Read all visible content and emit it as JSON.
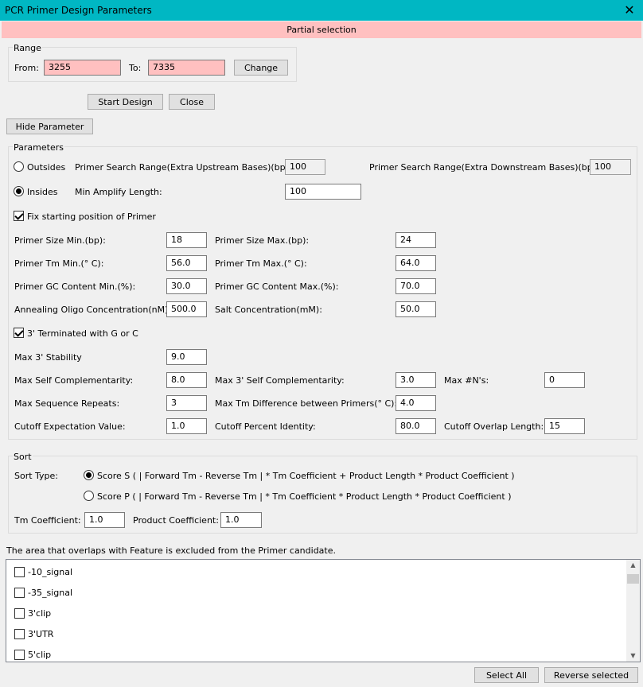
{
  "window": {
    "title": "PCR Primer Design Parameters",
    "close_glyph": "✕"
  },
  "banner": "Partial selection",
  "range": {
    "group_label": "Range",
    "from_label": "From:",
    "from_value": "3255",
    "to_label": "To:",
    "to_value": "7335",
    "change_label": "Change"
  },
  "actions": {
    "start_label": "Start Design",
    "close_label": "Close",
    "hide_label": "Hide Parameter"
  },
  "params": {
    "group_label": "Parameters",
    "outsides_label": "Outsides",
    "outsides_selected": false,
    "upstream_label": "Primer Search Range(Extra Upstream Bases)(bp):",
    "upstream_value": "100",
    "downstream_label": "Primer Search Range(Extra Downstream Bases)(bp):",
    "downstream_value": "100",
    "insides_label": "Insides",
    "insides_selected": true,
    "min_amplify_label": "Min Amplify Length:",
    "min_amplify_value": "100",
    "fix_start_label": "Fix starting position of Primer",
    "fix_start_checked": true,
    "size_min_label": "Primer Size Min.(bp):",
    "size_min_value": "18",
    "size_max_label": "Primer Size Max.(bp):",
    "size_max_value": "24",
    "tm_min_label": "Primer Tm Min.(° C):",
    "tm_min_value": "56.0",
    "tm_max_label": "Primer Tm Max.(° C):",
    "tm_max_value": "64.0",
    "gc_min_label": "Primer GC Content Min.(%):",
    "gc_min_value": "30.0",
    "gc_max_label": "Primer GC Content Max.(%):",
    "gc_max_value": "70.0",
    "oligo_conc_label": "Annealing Oligo Concentration(nM):",
    "oligo_conc_value": "500.0",
    "salt_conc_label": "Salt Concentration(mM):",
    "salt_conc_value": "50.0",
    "term_gc_label": "3' Terminated with G or C",
    "term_gc_checked": true,
    "max3_stab_label": "Max 3' Stability",
    "max3_stab_value": "9.0",
    "self_comp_label": "Max Self Complementarity:",
    "self_comp_value": "8.0",
    "self_comp3_label": "Max 3' Self Complementarity:",
    "self_comp3_value": "3.0",
    "max_n_label": "Max #N's:",
    "max_n_value": "0",
    "seq_repeats_label": "Max Sequence Repeats:",
    "seq_repeats_value": "3",
    "tm_diff_label": "Max Tm Difference between Primers(° C):",
    "tm_diff_value": "4.0",
    "cutoff_exp_label": "Cutoff Expectation Value:",
    "cutoff_exp_value": "1.0",
    "cutoff_pct_label": "Cutoff Percent Identity:",
    "cutoff_pct_value": "80.0",
    "cutoff_overlap_label": "Cutoff Overlap Length:",
    "cutoff_overlap_value": "15"
  },
  "sort": {
    "group_label": "Sort",
    "type_label": "Sort Type:",
    "score_s_label": "Score S ( | Forward Tm - Reverse Tm | * Tm Coefficient + Product Length * Product Coefficient )",
    "score_s_selected": true,
    "score_p_label": "Score P ( | Forward Tm - Reverse Tm | * Tm Coefficient * Product Length * Product Coefficient )",
    "score_p_selected": false,
    "tm_coef_label": "Tm Coefficient:",
    "tm_coef_value": "1.0",
    "prod_coef_label": "Product Coefficient:",
    "prod_coef_value": "1.0"
  },
  "features": {
    "note": "The area that overlaps with Feature is excluded from the Primer candidate.",
    "items": [
      {
        "label": "-10_signal",
        "checked": false
      },
      {
        "label": "-35_signal",
        "checked": false
      },
      {
        "label": "3'clip",
        "checked": false
      },
      {
        "label": "3'UTR",
        "checked": false
      },
      {
        "label": "5'clip",
        "checked": false
      }
    ],
    "select_all_label": "Select All",
    "reverse_label": "Reverse selected"
  }
}
